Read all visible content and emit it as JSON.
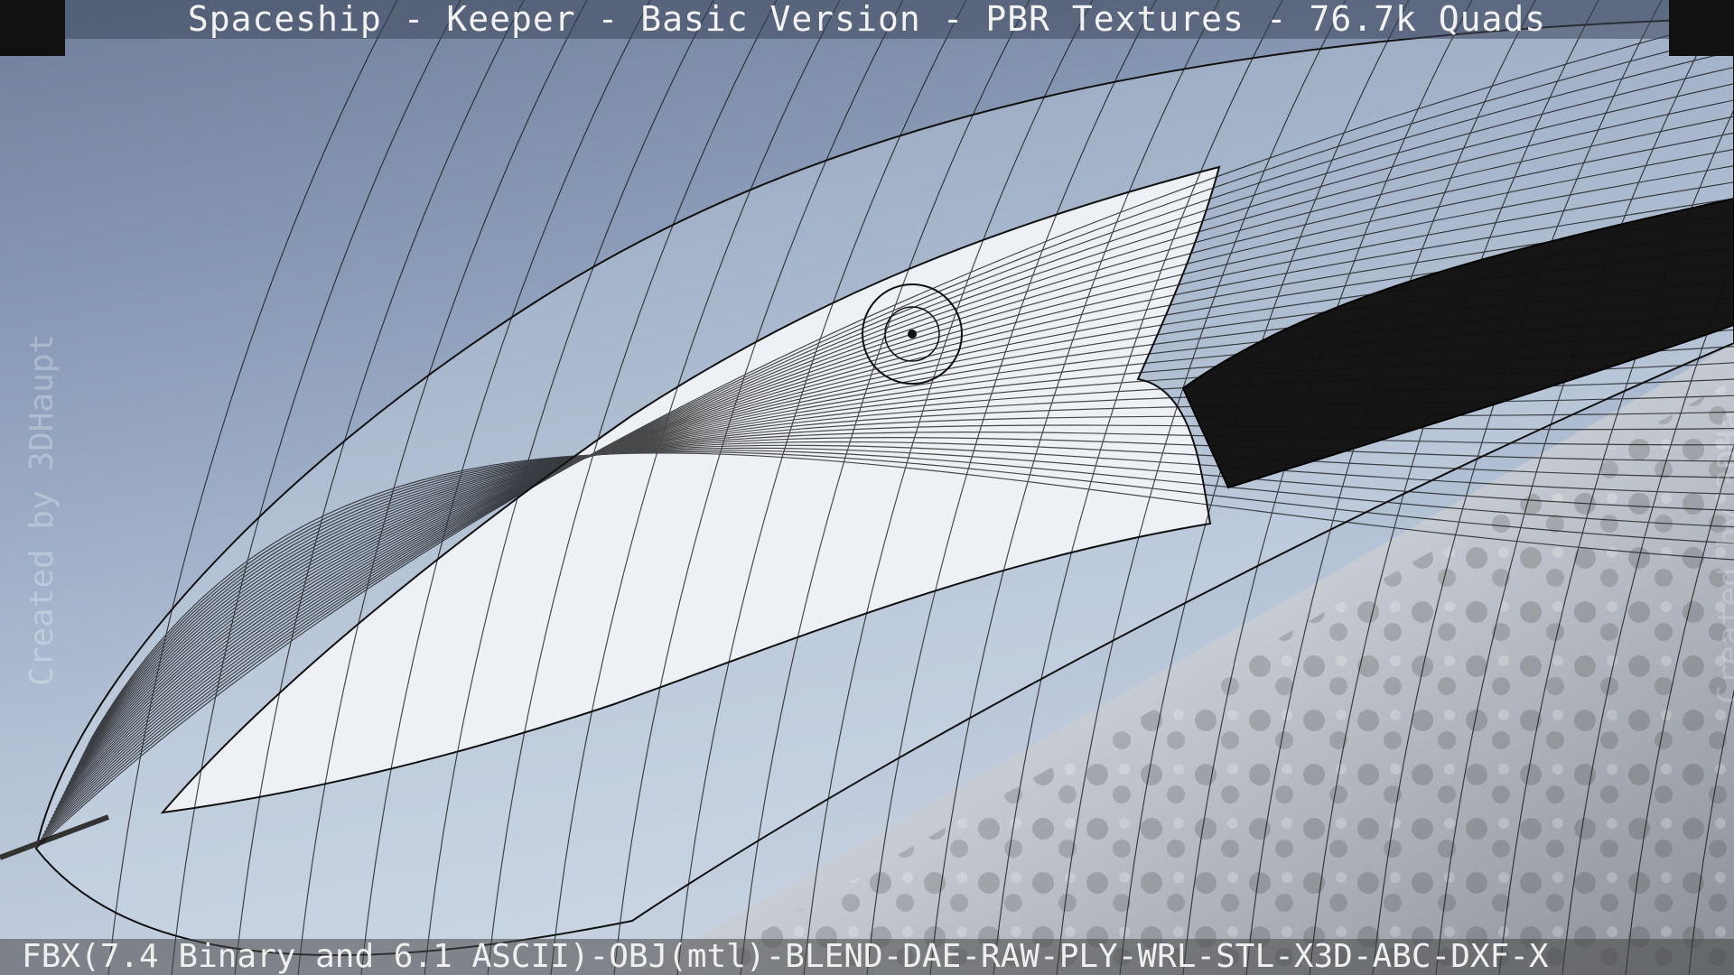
{
  "header": {
    "title": "Spaceship - Keeper - Basic Version - PBR Textures - 76.7k Quads"
  },
  "footer": {
    "formats": "FBX(7.4 Binary and 6.1 ASCII)-OBJ(mtl)-BLEND-DAE-RAW-PLY-WRL-STL-X3D-ABC-DXF-X"
  },
  "watermarks": {
    "left": "Created by 3DHaupt",
    "right": "Created by 3DHa"
  },
  "colors": {
    "sky_top": "#6f7f9a",
    "sky_bottom": "#d5dde8",
    "wire": "#0a0a0a",
    "hull": "#e9edf2"
  }
}
